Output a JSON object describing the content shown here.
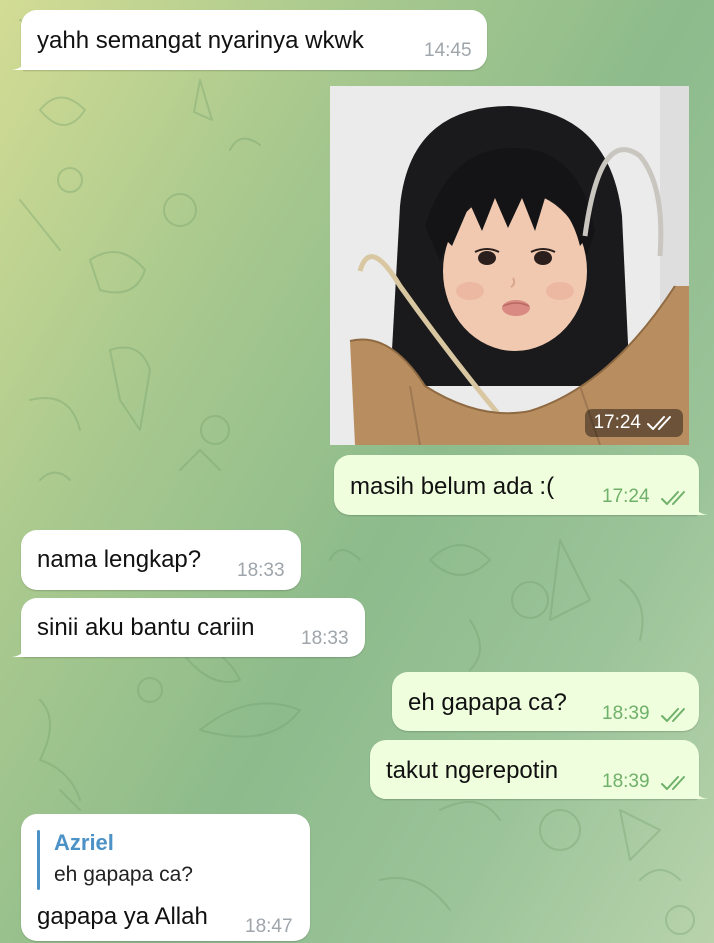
{
  "theme": {
    "incoming_bubble": "#ffffff",
    "outgoing_bubble": "#effedd",
    "outgoing_meta": "#6fb06a",
    "incoming_meta": "#9ea5ab",
    "reply_accent": "#4c92c7"
  },
  "messages": [
    {
      "id": "m1",
      "direction": "in",
      "text": "yahh semangat nyarinya wkwk",
      "time": "14:45"
    },
    {
      "id": "m2",
      "direction": "out",
      "type": "photo",
      "photo_subject": "toddler-in-paper-bag",
      "time": "17:24",
      "status": "read-double-check"
    },
    {
      "id": "m3",
      "direction": "out",
      "text": "masih belum ada :(",
      "time": "17:24",
      "status": "read-double-check"
    },
    {
      "id": "m4",
      "direction": "in",
      "text": "nama lengkap?",
      "time": "18:33"
    },
    {
      "id": "m5",
      "direction": "in",
      "text": "sinii aku bantu cariin",
      "time": "18:33"
    },
    {
      "id": "m6",
      "direction": "out",
      "text": "eh gapapa ca?",
      "time": "18:39",
      "status": "read-double-check"
    },
    {
      "id": "m7",
      "direction": "out",
      "text": "takut ngerepotin",
      "time": "18:39",
      "status": "read-double-check"
    },
    {
      "id": "m8",
      "direction": "in",
      "reply_to": {
        "author": "Azriel",
        "text": "eh gapapa ca?"
      },
      "text": "gapapa ya Allah",
      "time": "18:47"
    }
  ]
}
